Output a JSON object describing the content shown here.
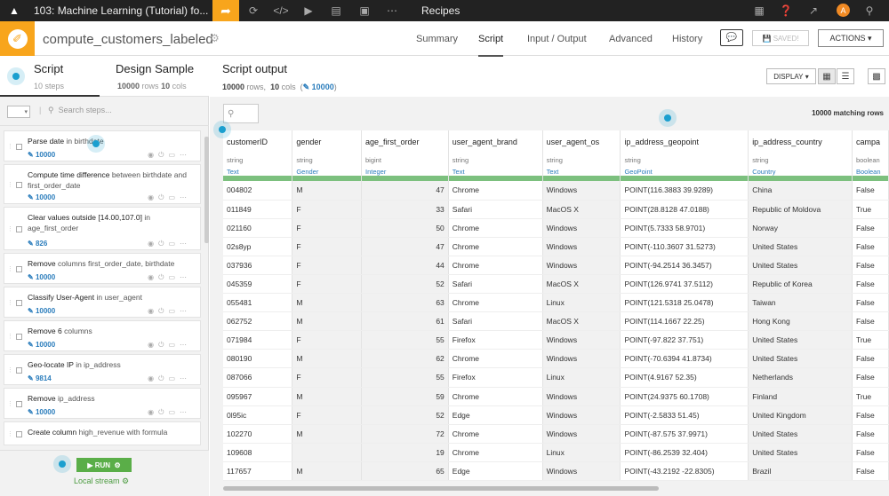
{
  "topbar": {
    "project": "103: Machine Learning (Tutorial) fo...",
    "section": "Recipes",
    "avatar": "A"
  },
  "header": {
    "recipe_name": "compute_customers_labeled",
    "tabs": [
      "Summary",
      "Script",
      "Input / Output",
      "Advanced",
      "History"
    ],
    "active_tab": "Script",
    "saved_label": "SAVED!",
    "actions_label": "ACTIONS"
  },
  "left": {
    "tab_script": "Script",
    "tab_script_sub": "10 steps",
    "tab_design": "Design Sample",
    "tab_design_sub_rows": "10000",
    "tab_design_sub_rows_label": "rows",
    "tab_design_sub_cols": "10",
    "tab_design_sub_cols_label": "cols",
    "search_placeholder": "Search steps...",
    "steps": [
      {
        "title": "Parse date",
        "rest": " in birthdate",
        "count": "10000"
      },
      {
        "title": "Compute time difference",
        "rest": " between birthdate and first_order_date",
        "count": "10000"
      },
      {
        "title": "Clear values outside [14.00,107.0]",
        "rest": " in age_first_order",
        "count": "826"
      },
      {
        "title": "Remove",
        "rest": " columns first_order_date, birthdate",
        "count": "10000"
      },
      {
        "title": "Classify User-Agent",
        "rest": " in user_agent",
        "count": "10000"
      },
      {
        "title": "Remove 6",
        "rest": " columns",
        "count": "10000"
      },
      {
        "title": "Geo-locate IP",
        "rest": " in ip_address",
        "count": "9814"
      },
      {
        "title": "Remove",
        "rest": " ip_address",
        "count": "10000"
      },
      {
        "title": "Create column",
        "rest": " high_revenue with formula",
        "count": ""
      }
    ],
    "run_label": "RUN",
    "local_stream": "Local stream"
  },
  "main": {
    "title": "Script output",
    "rows": "10000",
    "rows_label": "rows,",
    "cols": "10",
    "cols_label": "cols",
    "count_badge": "10000",
    "display_label": "DISPLAY",
    "matching": "10000 matching rows",
    "columns": [
      {
        "name": "customerID",
        "type": "string",
        "meaning": "Text"
      },
      {
        "name": "gender",
        "type": "string",
        "meaning": "Gender"
      },
      {
        "name": "age_first_order",
        "type": "bigint",
        "meaning": "Integer"
      },
      {
        "name": "user_agent_brand",
        "type": "string",
        "meaning": "Text"
      },
      {
        "name": "user_agent_os",
        "type": "string",
        "meaning": "Text"
      },
      {
        "name": "ip_address_geopoint",
        "type": "string",
        "meaning": "GeoPoint"
      },
      {
        "name": "ip_address_country",
        "type": "string",
        "meaning": "Country"
      },
      {
        "name": "campa",
        "type": "boolean",
        "meaning": "Boolean"
      }
    ],
    "rows_data": [
      [
        "004802",
        "M",
        "47",
        "Chrome",
        "Windows",
        "POINT(116.3883 39.9289)",
        "China",
        "False"
      ],
      [
        "011849",
        "F",
        "33",
        "Safari",
        "MacOS X",
        "POINT(28.8128 47.0188)",
        "Republic of Moldova",
        "True"
      ],
      [
        "021160",
        "F",
        "50",
        "Chrome",
        "Windows",
        "POINT(5.7333 58.9701)",
        "Norway",
        "False"
      ],
      [
        "02s8yp",
        "F",
        "47",
        "Chrome",
        "Windows",
        "POINT(-110.3607 31.5273)",
        "United States",
        "False"
      ],
      [
        "037936",
        "F",
        "44",
        "Chrome",
        "Windows",
        "POINT(-94.2514 36.3457)",
        "United States",
        "False"
      ],
      [
        "045359",
        "F",
        "52",
        "Safari",
        "MacOS X",
        "POINT(126.9741 37.5112)",
        "Republic of Korea",
        "False"
      ],
      [
        "055481",
        "M",
        "63",
        "Chrome",
        "Linux",
        "POINT(121.5318 25.0478)",
        "Taiwan",
        "False"
      ],
      [
        "062752",
        "M",
        "61",
        "Safari",
        "MacOS X",
        "POINT(114.1667 22.25)",
        "Hong Kong",
        "False"
      ],
      [
        "071984",
        "F",
        "55",
        "Firefox",
        "Windows",
        "POINT(-97.822 37.751)",
        "United States",
        "True"
      ],
      [
        "080190",
        "M",
        "62",
        "Chrome",
        "Windows",
        "POINT(-70.6394 41.8734)",
        "United States",
        "False"
      ],
      [
        "087066",
        "F",
        "55",
        "Firefox",
        "Linux",
        "POINT(4.9167 52.35)",
        "Netherlands",
        "False"
      ],
      [
        "095967",
        "M",
        "59",
        "Chrome",
        "Windows",
        "POINT(24.9375 60.1708)",
        "Finland",
        "True"
      ],
      [
        "0l95ic",
        "F",
        "52",
        "Edge",
        "Windows",
        "POINT(-2.5833 51.45)",
        "United Kingdom",
        "False"
      ],
      [
        "102270",
        "M",
        "72",
        "Chrome",
        "Windows",
        "POINT(-87.575 37.9971)",
        "United States",
        "False"
      ],
      [
        "109608",
        "",
        "19",
        "Chrome",
        "Linux",
        "POINT(-86.2539 32.404)",
        "United States",
        "False"
      ],
      [
        "117657",
        "M",
        "65",
        "Edge",
        "Windows",
        "POINT(-43.2192 -22.8305)",
        "Brazil",
        "False"
      ]
    ]
  }
}
